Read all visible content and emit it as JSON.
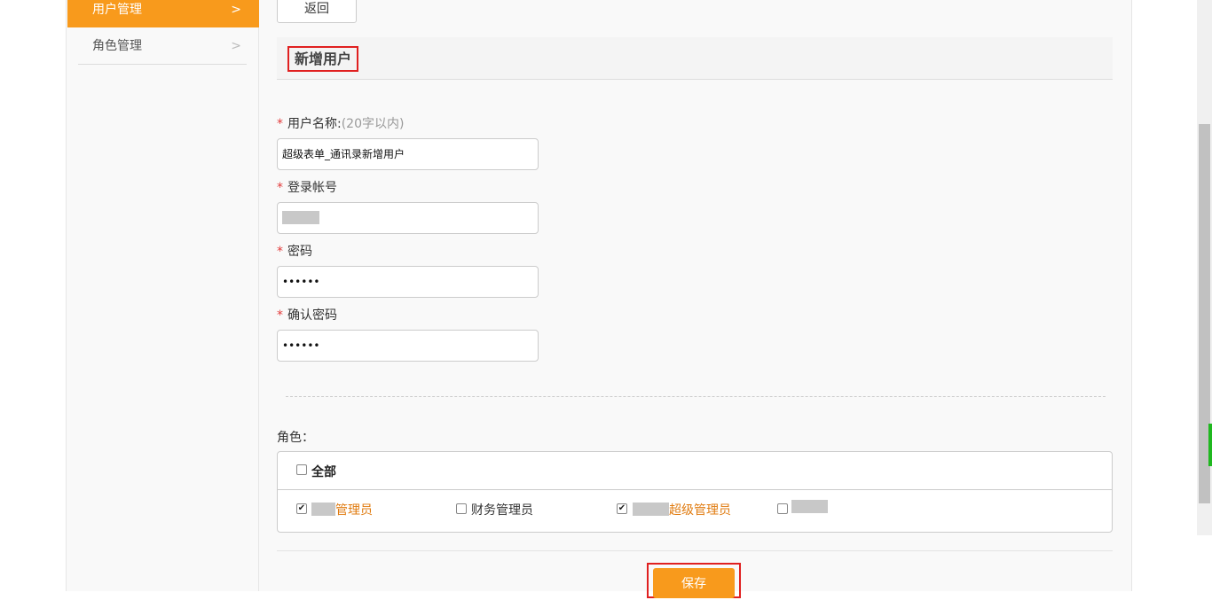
{
  "sidebar": {
    "items": [
      {
        "label": "用户管理",
        "chevron": ">",
        "active": true
      },
      {
        "label": "角色管理",
        "chevron": ">",
        "active": false
      }
    ]
  },
  "toolbar": {
    "back_label": "返回"
  },
  "section": {
    "title": "新增用户"
  },
  "form": {
    "username": {
      "required_mark": "*",
      "label": "用户名称:",
      "hint": "(20字以内)",
      "value": "超级表单_通讯录新增用户"
    },
    "account": {
      "required_mark": "*",
      "label": "登录帐号",
      "value": ""
    },
    "password": {
      "required_mark": "*",
      "label": "密码",
      "value": "••••••"
    },
    "confirm_password": {
      "required_mark": "*",
      "label": "确认密码",
      "value": "••••••"
    }
  },
  "roles": {
    "label": "角色：",
    "all_label": "全部",
    "all_checked": false,
    "items": [
      {
        "label": "管理员",
        "checked": true
      },
      {
        "label": "财务管理员",
        "checked": false
      },
      {
        "label": "超级管理员",
        "checked": true
      },
      {
        "label": "",
        "checked": false
      }
    ]
  },
  "actions": {
    "save_label": "保存"
  },
  "colors": {
    "accent": "#f89a1c",
    "highlight": "#e02020",
    "role_checked": "#e07b10"
  }
}
